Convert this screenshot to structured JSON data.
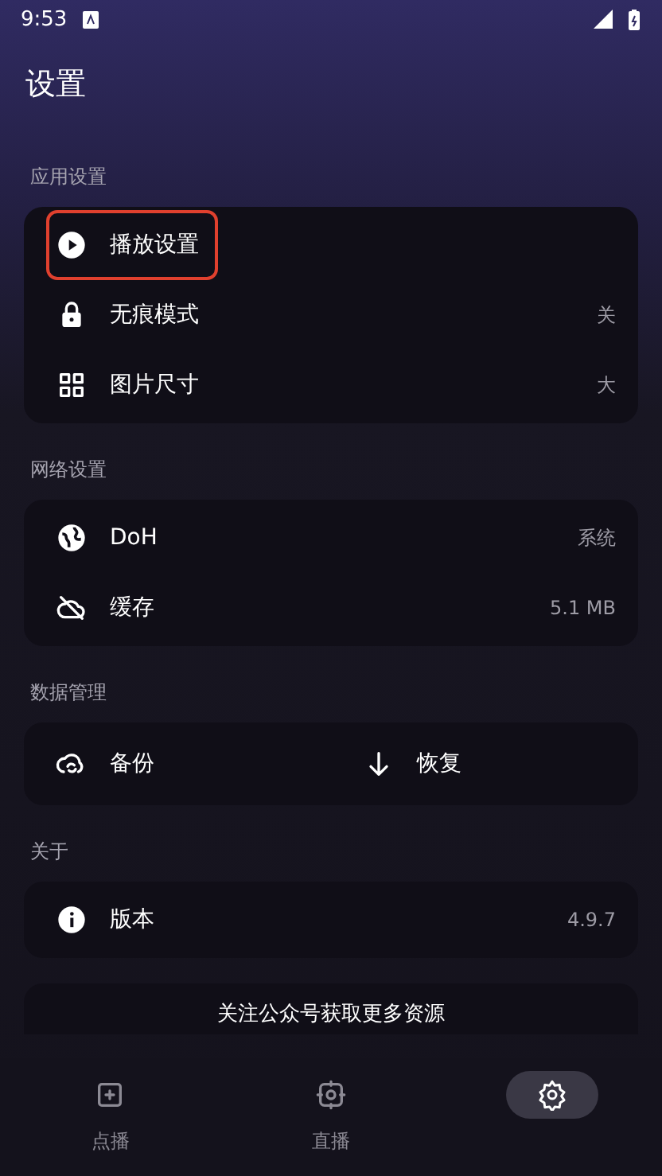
{
  "status_bar": {
    "time": "9:53"
  },
  "title": "设置",
  "sections": [
    {
      "label": "应用设置",
      "items": [
        {
          "label": "播放设置",
          "highlighted": true
        },
        {
          "label": "无痕模式",
          "value": "关",
          "highlighted": false
        },
        {
          "label": "图片尺寸",
          "value": "大",
          "highlighted": false
        }
      ]
    },
    {
      "label": "网络设置",
      "items": [
        {
          "label": "DoH",
          "value": "系统",
          "highlighted": false
        },
        {
          "label": "缓存",
          "value": "5.1 MB",
          "highlighted": false
        }
      ]
    },
    {
      "label": "数据管理",
      "actions": [
        {
          "label": "备份"
        },
        {
          "label": "恢复"
        }
      ]
    },
    {
      "label": "关于",
      "items": [
        {
          "label": "版本",
          "value": "4.9.7",
          "highlighted": false
        }
      ]
    }
  ],
  "promo": {
    "text": "关注公众号获取更多资源"
  },
  "nav": [
    {
      "label": "点播",
      "selected": false
    },
    {
      "label": "直播",
      "selected": false
    },
    {
      "selected": true
    }
  ]
}
